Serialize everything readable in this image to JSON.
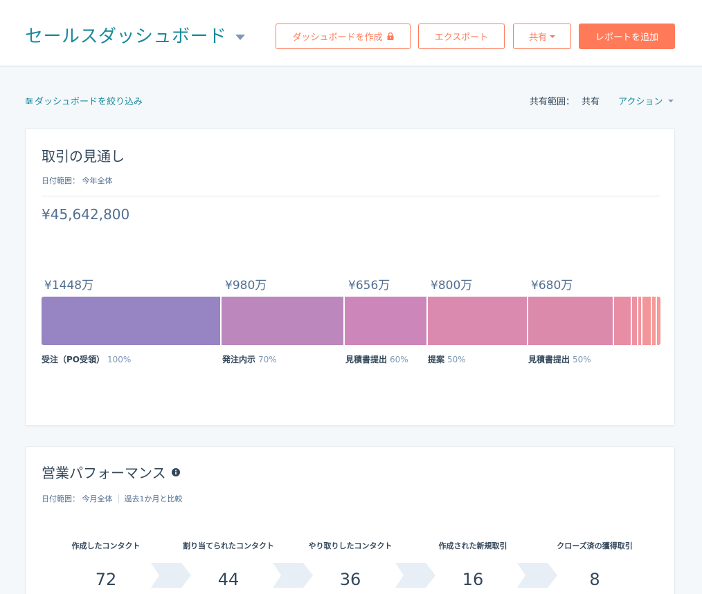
{
  "header": {
    "title": "セールスダッシュボード",
    "create_dashboard_label": "ダッシュボードを作成",
    "export_label": "エクスポート",
    "share_label": "共有",
    "add_report_label": "レポートを追加"
  },
  "toolbar": {
    "filter_label": "ダッシュボードを絞り込み",
    "scope_label": "共有範囲：",
    "scope_value": "共有",
    "actions_label": "アクション"
  },
  "deal_forecast": {
    "title": "取引の見通し",
    "date_range": "日付範囲： 今年全体",
    "total": "¥45,642,800",
    "stages": [
      {
        "value": "¥1448万",
        "label": "受注（PO受領）",
        "pct": "100%",
        "color": "#9784c2"
      },
      {
        "value": "¥980万",
        "label": "発注内示",
        "pct": "70%",
        "color": "#bb87bd"
      },
      {
        "value": "¥656万",
        "label": "見積書提出",
        "pct": "60%",
        "color": "#cd86ba"
      },
      {
        "value": "¥800万",
        "label": "提案",
        "pct": "50%",
        "color": "#db8aaf"
      },
      {
        "value": "¥680万",
        "label": "見積書提出",
        "pct": "50%",
        "color": "#dc8aac"
      }
    ],
    "tail_colors": [
      "#e88ea4",
      "#ee91a0",
      "#f1949d",
      "#f3969a",
      "#f49898",
      "#f59a96"
    ]
  },
  "sales_performance": {
    "title": "営業パフォーマンス",
    "date_range": "日付範囲： 今月全体",
    "comparison": "過去1か月と比較",
    "metrics": [
      {
        "label": "作成したコンタクト",
        "value": "72"
      },
      {
        "label": "割り当てられたコンタクト",
        "value": "44"
      },
      {
        "label": "やり取りしたコンタクト",
        "value": "36"
      },
      {
        "label": "作成された新規取引",
        "value": "16"
      },
      {
        "label": "クローズ済の獲得取引",
        "value": "8"
      }
    ]
  },
  "colors": {
    "accent": "#ff7a59",
    "link": "#1a8a9a",
    "text": "#33475b"
  }
}
